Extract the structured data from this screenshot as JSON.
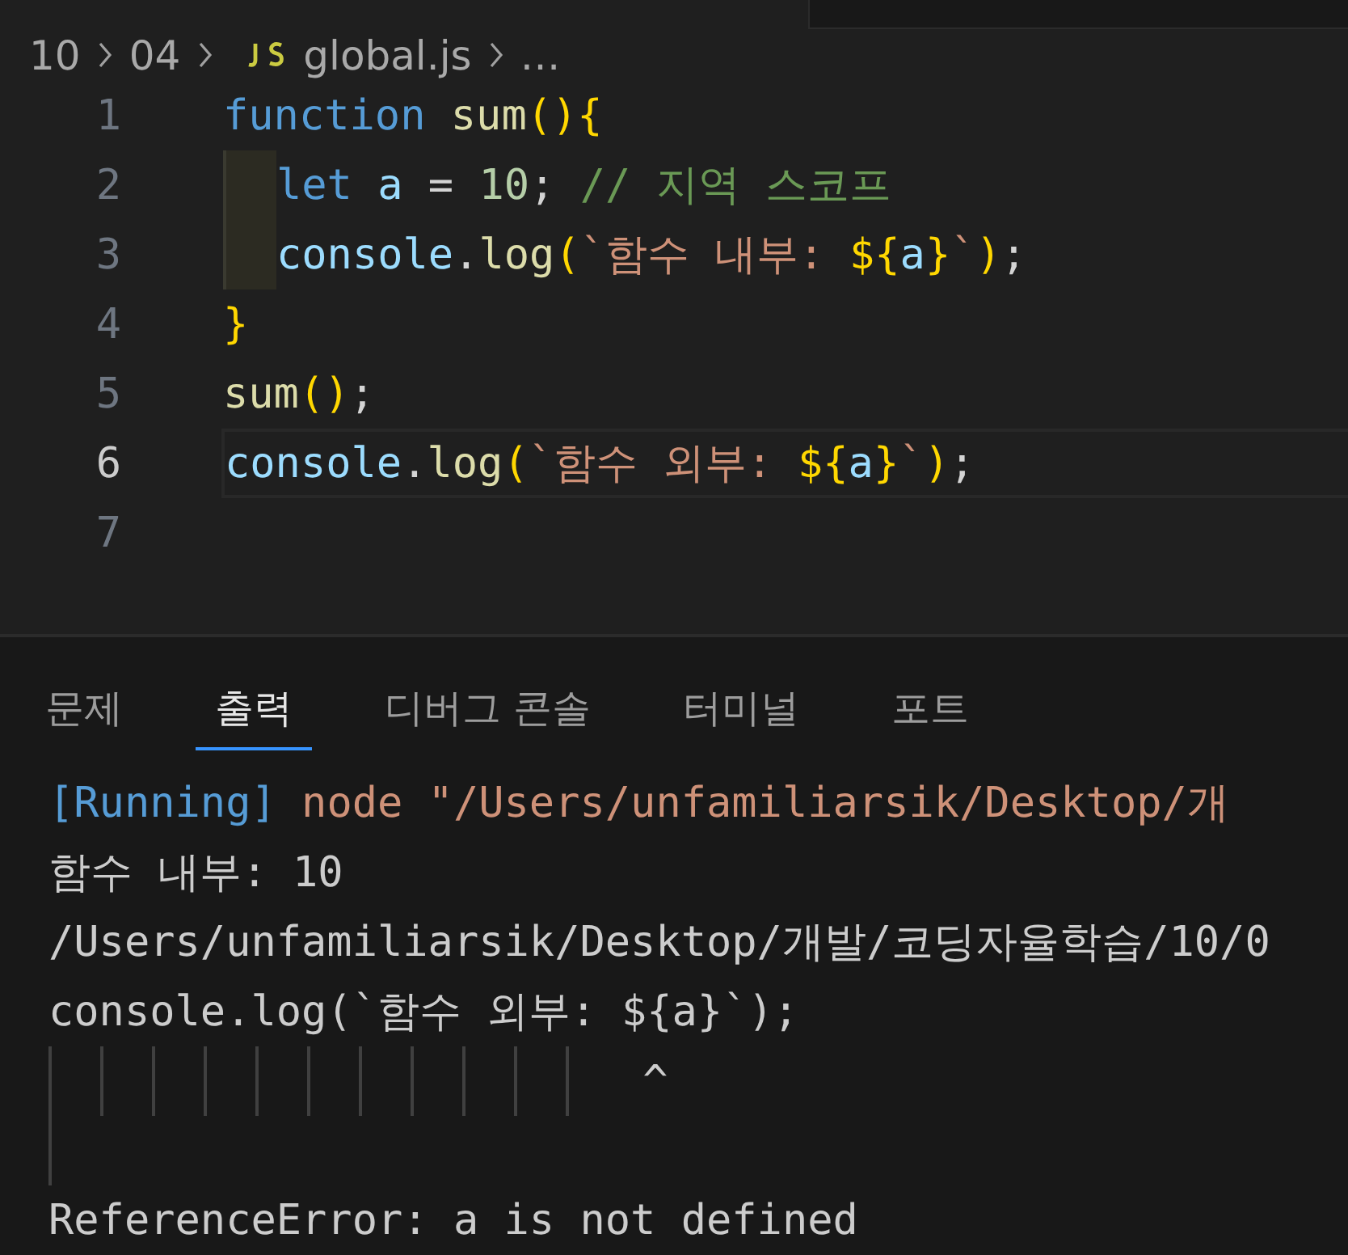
{
  "breadcrumb": [
    {
      "kind": "folder",
      "text": "10"
    },
    {
      "kind": "folder",
      "text": "04"
    },
    {
      "kind": "js-file",
      "text": "global.js"
    },
    {
      "kind": "more",
      "text": "…"
    }
  ],
  "editor": {
    "lines": [
      {
        "number": "1",
        "current": false,
        "indented": false,
        "tokens": [
          {
            "kind": "keyword",
            "text": "function "
          },
          {
            "kind": "func",
            "text": "sum"
          },
          {
            "kind": "bracket",
            "text": "(){"
          }
        ]
      },
      {
        "number": "2",
        "current": false,
        "indented": true,
        "tokens": [
          {
            "kind": "keyword",
            "text": "let "
          },
          {
            "kind": "variable",
            "text": "a"
          },
          {
            "kind": "plain",
            "text": " = "
          },
          {
            "kind": "number",
            "text": "10"
          },
          {
            "kind": "plain",
            "text": "; "
          },
          {
            "kind": "comment",
            "text": "// 지역 스코프"
          }
        ]
      },
      {
        "number": "3",
        "current": false,
        "indented": true,
        "tokens": [
          {
            "kind": "variable",
            "text": "console"
          },
          {
            "kind": "plain",
            "text": "."
          },
          {
            "kind": "func",
            "text": "log"
          },
          {
            "kind": "bracket",
            "text": "("
          },
          {
            "kind": "string",
            "text": "`함수 내부: "
          },
          {
            "kind": "bracket",
            "text": "${"
          },
          {
            "kind": "variable",
            "text": "a"
          },
          {
            "kind": "bracket",
            "text": "}"
          },
          {
            "kind": "string",
            "text": "`"
          },
          {
            "kind": "bracket",
            "text": ")"
          },
          {
            "kind": "plain",
            "text": ";"
          }
        ]
      },
      {
        "number": "4",
        "current": false,
        "indented": false,
        "tokens": [
          {
            "kind": "bracket",
            "text": "}"
          }
        ]
      },
      {
        "number": "5",
        "current": false,
        "indented": false,
        "tokens": [
          {
            "kind": "func",
            "text": "sum"
          },
          {
            "kind": "bracket",
            "text": "()"
          },
          {
            "kind": "plain",
            "text": ";"
          }
        ]
      },
      {
        "number": "6",
        "current": true,
        "indented": false,
        "tokens": [
          {
            "kind": "variable",
            "text": "console"
          },
          {
            "kind": "plain",
            "text": "."
          },
          {
            "kind": "func",
            "text": "log"
          },
          {
            "kind": "bracket",
            "text": "("
          },
          {
            "kind": "string",
            "text": "`함수 외부: "
          },
          {
            "kind": "bracket",
            "text": "${"
          },
          {
            "kind": "variable",
            "text": "a"
          },
          {
            "kind": "bracket",
            "text": "}"
          },
          {
            "kind": "string",
            "text": "`"
          },
          {
            "kind": "bracket",
            "text": ")"
          },
          {
            "kind": "plain",
            "text": ";"
          }
        ]
      },
      {
        "number": "7",
        "current": false
      }
    ]
  },
  "panel": {
    "tabs": [
      {
        "label": "문제",
        "selected": false
      },
      {
        "label": "출력",
        "selected": true
      },
      {
        "label": "디버그 콘솔",
        "selected": false
      },
      {
        "label": "터미널",
        "selected": false
      },
      {
        "label": "포트",
        "selected": false
      }
    ],
    "output": [
      {
        "kind": "tokens",
        "tokens": [
          {
            "kind": "keyword",
            "text": "[Running]"
          },
          {
            "kind": "string",
            "text": " node \"/Users/unfamiliarsik/Desktop/개"
          }
        ]
      },
      {
        "kind": "text",
        "text": "함수 내부: 10"
      },
      {
        "kind": "text",
        "text": "/Users/unfamiliarsik/Desktop/개발/코딩자율학습/10/0"
      },
      {
        "kind": "text",
        "text": "console.log(`함수 외부: ${a}`);"
      },
      {
        "kind": "text",
        "text": "                       ^"
      },
      {
        "kind": "guide"
      },
      {
        "kind": "text",
        "text": "ReferenceError: a is not defined"
      }
    ]
  }
}
